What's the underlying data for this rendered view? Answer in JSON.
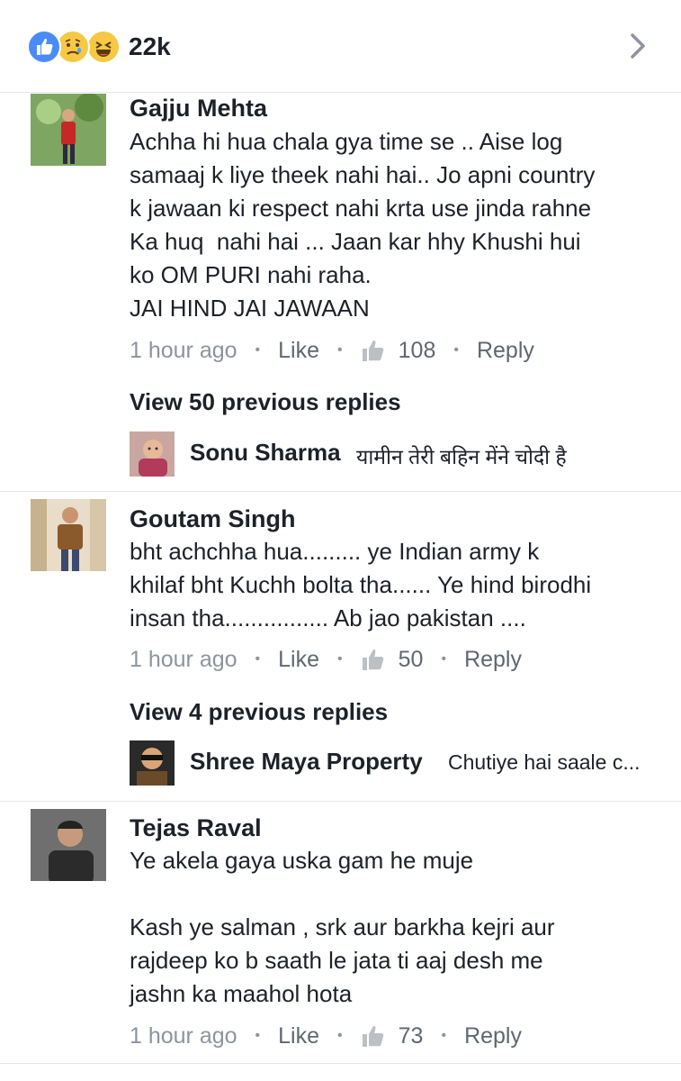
{
  "header": {
    "reaction_count": "22k",
    "reaction_icons": [
      "like-icon",
      "sad-icon",
      "haha-icon"
    ],
    "chevron_icon": "chevron-right-icon"
  },
  "comments": [
    {
      "author": "Gajju Mehta",
      "text": "Achha hi hua chala gya time se .. Aise log\nsamaaj k liye theek nahi hai.. Jo apni country\nk jawaan ki respect nahi krta use jinda rahne\nKa huq  nahi hai ... Jaan kar hhy Khushi hui\nko OM PURI nahi raha.\nJAI HIND JAI JAWAAN",
      "time": "1 hour ago",
      "like_label": "Like",
      "likes": "108",
      "reply_label": "Reply",
      "view_previous": "View 50 previous replies",
      "latest_reply": {
        "author": "Sonu Sharma",
        "text": "यामीन तेरी बहिन मेंने चोदी है"
      }
    },
    {
      "author": "Goutam Singh",
      "text": "bht achchha hua......... ye Indian army k\nkhilaf bht Kuchh bolta tha...... Ye hind birodhi\ninsan tha................ Ab jao pakistan ....",
      "time": "1 hour ago",
      "like_label": "Like",
      "likes": "50",
      "reply_label": "Reply",
      "view_previous": "View 4 previous replies",
      "latest_reply": {
        "author": "Shree Maya Property",
        "text": "Chutiye hai saale c..."
      }
    },
    {
      "author": "Tejas Raval",
      "text": "Ye akela gaya uska gam he muje\n\nKash ye salman , srk aur barkha kejri aur\nrajdeep ko b saath le jata ti aaj desh me\njashn ka maahol hota",
      "time": "1 hour ago",
      "like_label": "Like",
      "likes": "73",
      "reply_label": "Reply"
    }
  ],
  "colors": {
    "like_blue": "#4a8cf7",
    "emoji_yellow": "#f7c843",
    "text_primary": "#1d2129",
    "text_secondary": "#606770",
    "text_muted": "#8d949e"
  }
}
